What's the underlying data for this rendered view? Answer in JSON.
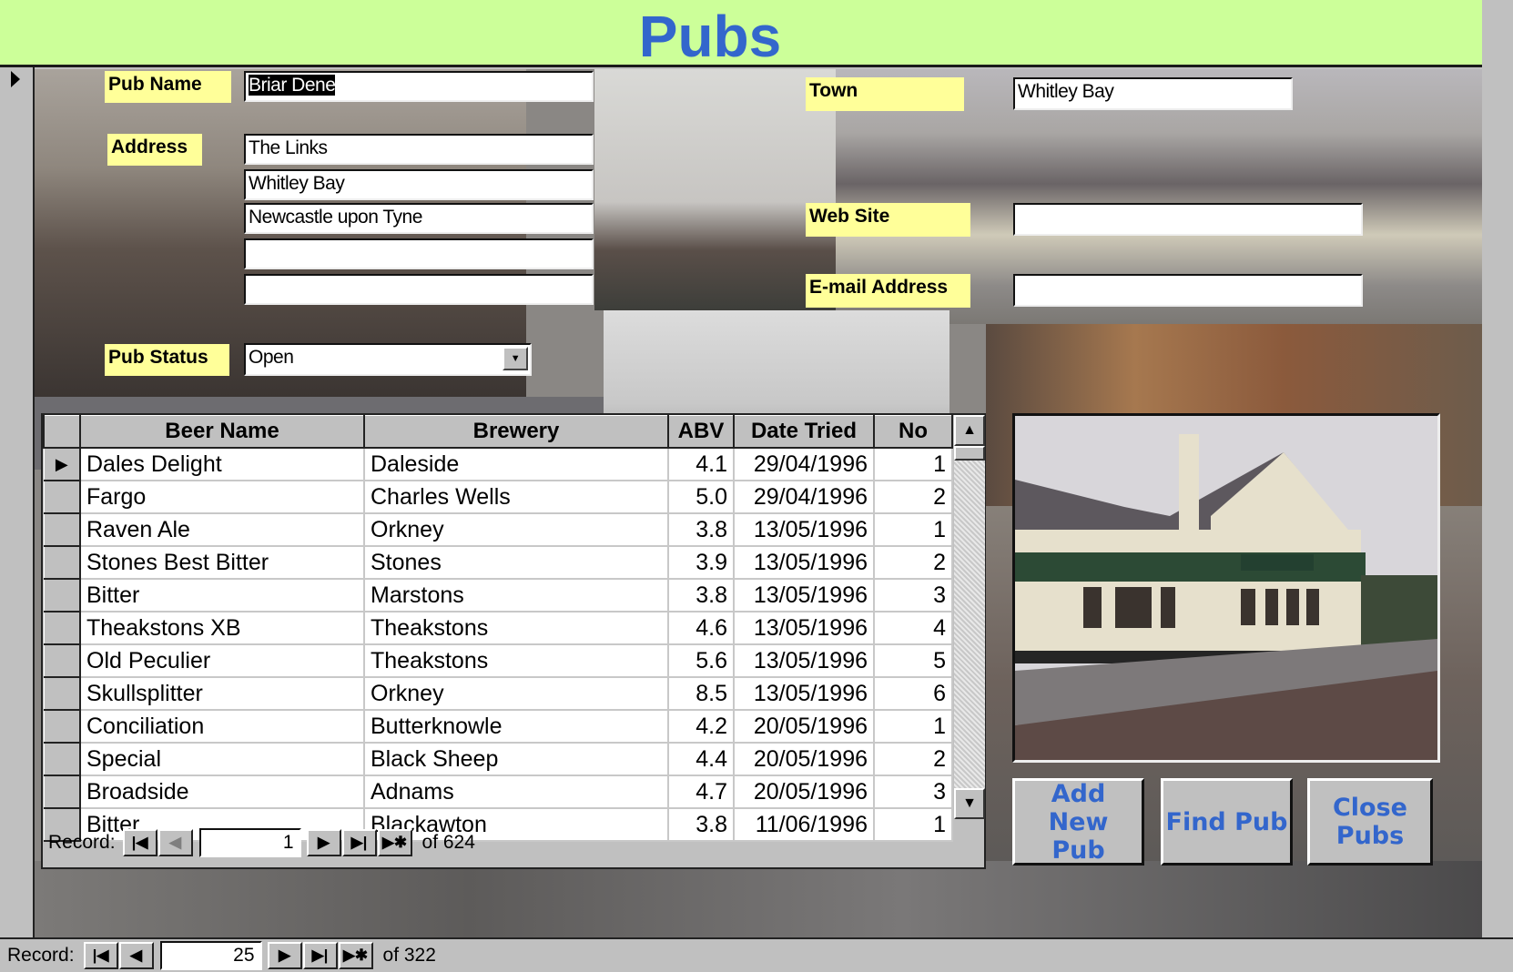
{
  "form": {
    "title": "Pubs",
    "record_selector_icon": "current-record-arrow"
  },
  "fields": {
    "pub_name": {
      "label": "Pub Name",
      "value": "Briar Dene"
    },
    "address": {
      "label": "Address",
      "lines": [
        "The Links",
        "Whitley Bay",
        "Newcastle upon Tyne",
        "",
        ""
      ]
    },
    "pub_status": {
      "label": "Pub Status",
      "value": "Open"
    },
    "town": {
      "label": "Town",
      "value": "Whitley Bay"
    },
    "web_site": {
      "label": "Web Site",
      "value": ""
    },
    "email": {
      "label": "E-mail Address",
      "value": ""
    }
  },
  "beers": {
    "columns": [
      "Beer Name",
      "Brewery",
      "ABV",
      "Date Tried",
      "No"
    ],
    "rows": [
      [
        "Dales Delight",
        "Daleside",
        "4.1",
        "29/04/1996",
        "1"
      ],
      [
        "Fargo",
        "Charles Wells",
        "5.0",
        "29/04/1996",
        "2"
      ],
      [
        "Raven Ale",
        "Orkney",
        "3.8",
        "13/05/1996",
        "1"
      ],
      [
        "Stones Best Bitter",
        "Stones",
        "3.9",
        "13/05/1996",
        "2"
      ],
      [
        "Bitter",
        "Marstons",
        "3.8",
        "13/05/1996",
        "3"
      ],
      [
        "Theakstons XB",
        "Theakstons",
        "4.6",
        "13/05/1996",
        "4"
      ],
      [
        "Old Peculier",
        "Theakstons",
        "5.6",
        "13/05/1996",
        "5"
      ],
      [
        "Skullsplitter",
        "Orkney",
        "8.5",
        "13/05/1996",
        "6"
      ],
      [
        "Conciliation",
        "Butterknowle",
        "4.2",
        "20/05/1996",
        "1"
      ],
      [
        "Special",
        "Black Sheep",
        "4.4",
        "20/05/1996",
        "2"
      ],
      [
        "Broadside",
        "Adnams",
        "4.7",
        "20/05/1996",
        "3"
      ],
      [
        "Bitter",
        "Blackawton",
        "3.8",
        "11/06/1996",
        "1"
      ]
    ],
    "navigator": {
      "label": "Record:",
      "current": "1",
      "of_text": "of 624"
    }
  },
  "buttons": {
    "add_new_pub": "Add New Pub",
    "find_pub": "Find Pub",
    "close_pubs": "Close Pubs"
  },
  "main_navigator": {
    "label": "Record:",
    "current": "25",
    "of_text": "of 322"
  },
  "nav_glyphs": {
    "first": "|◀",
    "prev": "◀",
    "next": "▶",
    "last": "▶|",
    "new": "▶✱"
  },
  "colors": {
    "title_bg": "#ccff99",
    "title_text": "#3366cc",
    "label_bg": "#ffff99",
    "button_text": "#3366cc"
  }
}
